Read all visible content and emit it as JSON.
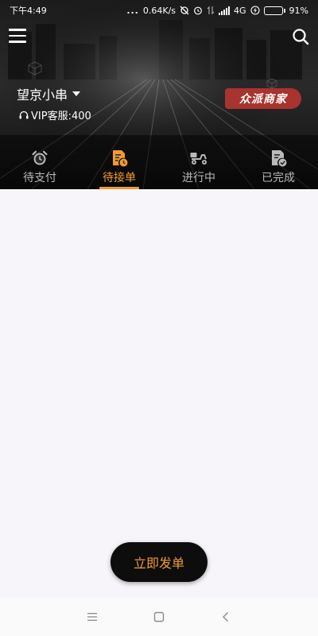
{
  "status_bar": {
    "time": "下午4:49",
    "dots": "...",
    "network_speed": "0.64K/s",
    "network_type": "4G",
    "battery_percent": "91%",
    "battery_level": 0.91
  },
  "header": {
    "store_name": "望京小串",
    "vip_service": "VIP客服:400",
    "brand_badge": "众派商家"
  },
  "tabs": [
    {
      "label": "待支付",
      "icon": "alarm-clock-icon",
      "active": false
    },
    {
      "label": "待接单",
      "icon": "order-pending-icon",
      "active": true
    },
    {
      "label": "进行中",
      "icon": "scooter-icon",
      "active": false
    },
    {
      "label": "已完成",
      "icon": "order-done-icon",
      "active": false
    }
  ],
  "actions": {
    "publish_label": "立即发单"
  },
  "colors": {
    "accent": "#f29a2e",
    "header_bg": "#151515",
    "badge_bg": "#a8332f",
    "inactive_tab": "#b9b9b9",
    "content_bg": "#f7f5f9"
  }
}
